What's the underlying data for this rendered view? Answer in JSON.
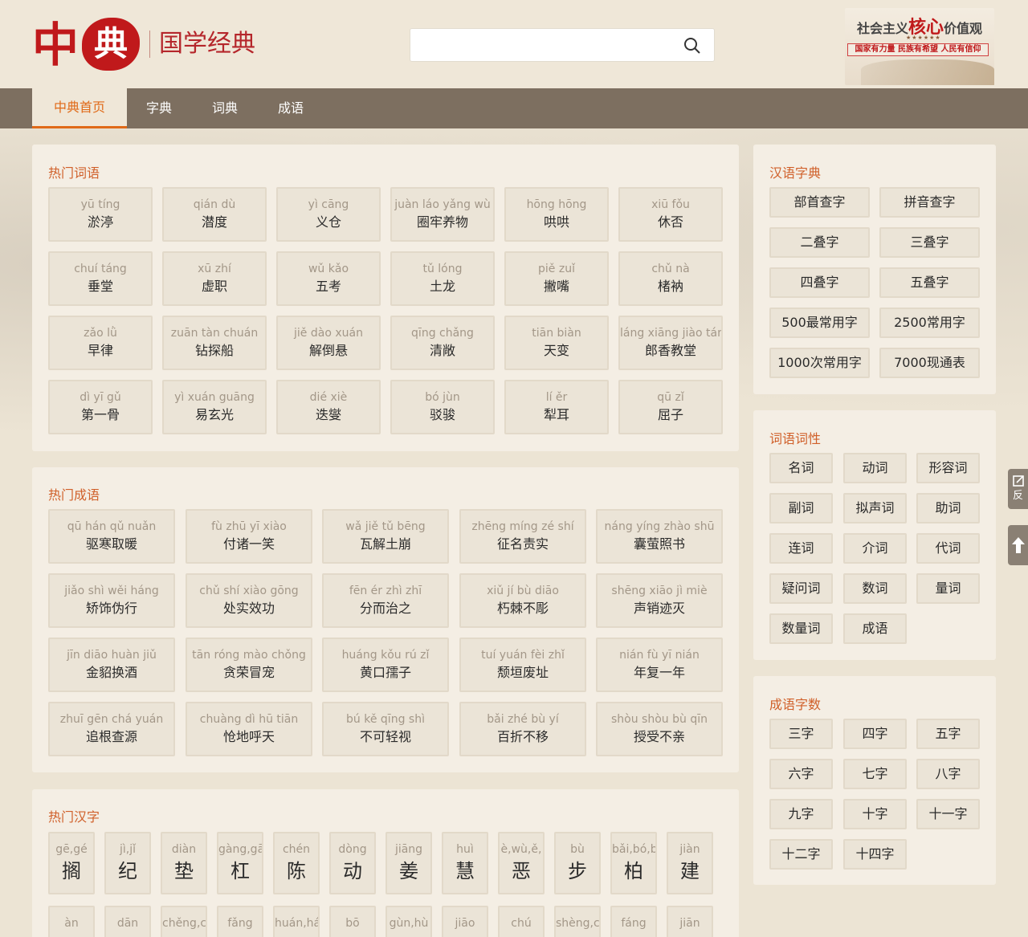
{
  "header": {
    "logo_char1": "中",
    "logo_char2": "典",
    "site_name": "国学经典",
    "search_placeholder": "",
    "ad": {
      "line1_a": "社会主义",
      "line1_b": "核心",
      "line1_c": "价值观",
      "stars": "★★★★★★",
      "line2": "国家有力量 民族有希望 人民有信仰"
    }
  },
  "nav": {
    "items": [
      "中典首页",
      "字典",
      "词典",
      "成语"
    ],
    "active_index": 0
  },
  "hot_words": {
    "title": "热门词语",
    "items": [
      {
        "py": "yū tíng",
        "zh": "淤渟"
      },
      {
        "py": "qián dù",
        "zh": "潜度"
      },
      {
        "py": "yì cāng",
        "zh": "义仓"
      },
      {
        "py": "juàn láo yǎng wù",
        "zh": "圈牢养物"
      },
      {
        "py": "hōng hōng",
        "zh": "哄哄"
      },
      {
        "py": "xiū fǒu",
        "zh": "休否"
      },
      {
        "py": "chuí táng",
        "zh": "垂堂"
      },
      {
        "py": "xū zhí",
        "zh": "虚职"
      },
      {
        "py": "wǔ kǎo",
        "zh": "五考"
      },
      {
        "py": "tǔ lóng",
        "zh": "土龙"
      },
      {
        "py": "piě zuǐ",
        "zh": "撇嘴"
      },
      {
        "py": "chǔ nà",
        "zh": "楮衲"
      },
      {
        "py": "zǎo lǜ",
        "zh": "早律"
      },
      {
        "py": "zuān tàn chuán",
        "zh": "钻探船"
      },
      {
        "py": "jiě dào xuán",
        "zh": "解倒悬"
      },
      {
        "py": "qīng chǎng",
        "zh": "清敞"
      },
      {
        "py": "tiān biàn",
        "zh": "天变"
      },
      {
        "py": "láng xiāng jiào tán",
        "zh": "郎香教堂"
      },
      {
        "py": "dì yī gǔ",
        "zh": "第一骨"
      },
      {
        "py": "yì xuán guāng",
        "zh": "易玄光"
      },
      {
        "py": "dié xiè",
        "zh": "迭燮"
      },
      {
        "py": "bó jùn",
        "zh": "驳骏"
      },
      {
        "py": "lí ěr",
        "zh": "犁耳"
      },
      {
        "py": "qū zǐ",
        "zh": "屈子"
      }
    ]
  },
  "hot_idioms": {
    "title": "热门成语",
    "items": [
      {
        "py": "qū hán qǔ nuǎn",
        "zh": "驱寒取暖"
      },
      {
        "py": "fù zhū yī xiào",
        "zh": "付诸一笑"
      },
      {
        "py": "wǎ jiě tǔ bēng",
        "zh": "瓦解土崩"
      },
      {
        "py": "zhēng míng zé shí",
        "zh": "征名责实"
      },
      {
        "py": "náng yíng zhào shū",
        "zh": "囊萤照书"
      },
      {
        "py": "jiǎo shì wěi háng",
        "zh": "矫饰伪行"
      },
      {
        "py": "chǔ shí xiào gōng",
        "zh": "处实效功"
      },
      {
        "py": "fēn ér zhì zhī",
        "zh": "分而治之"
      },
      {
        "py": "xiǔ jí bù diāo",
        "zh": "朽棘不彫"
      },
      {
        "py": "shēng xiāo jì miè",
        "zh": "声销迹灭"
      },
      {
        "py": "jīn diāo huàn jiǔ",
        "zh": "金貂换酒"
      },
      {
        "py": "tān róng mào chǒng",
        "zh": "贪荣冒宠"
      },
      {
        "py": "huáng kǒu rú zǐ",
        "zh": "黄口孺子"
      },
      {
        "py": "tuí yuán fèi zhǐ",
        "zh": "颓垣废址"
      },
      {
        "py": "nián fù yī nián",
        "zh": "年复一年"
      },
      {
        "py": "zhuī gēn chá yuán",
        "zh": "追根查源"
      },
      {
        "py": "chuàng dì hū tiān",
        "zh": "怆地呼天"
      },
      {
        "py": "bú kě qīng shì",
        "zh": "不可轻视"
      },
      {
        "py": "bǎi zhé bù yí",
        "zh": "百折不移"
      },
      {
        "py": "shòu shòu bù qīn",
        "zh": "授受不亲"
      }
    ]
  },
  "hot_chars": {
    "title": "热门汉字",
    "row1": [
      {
        "py": "gē,gé",
        "zh": "搁"
      },
      {
        "py": "jì,jǐ",
        "zh": "纪"
      },
      {
        "py": "diàn",
        "zh": "垫"
      },
      {
        "py": "gàng,gā",
        "zh": "杠"
      },
      {
        "py": "chén",
        "zh": "陈"
      },
      {
        "py": "dòng",
        "zh": "动"
      },
      {
        "py": "jiāng",
        "zh": "姜"
      },
      {
        "py": "huì",
        "zh": "慧"
      },
      {
        "py": "è,wù,ě,",
        "zh": "恶"
      },
      {
        "py": "bù",
        "zh": "步"
      },
      {
        "py": "bǎi,bó,b",
        "zh": "柏"
      },
      {
        "py": "jiàn",
        "zh": "建"
      }
    ],
    "row2": [
      {
        "py": "àn"
      },
      {
        "py": "dān"
      },
      {
        "py": "chěng,c"
      },
      {
        "py": "fǎng"
      },
      {
        "py": "huán,há"
      },
      {
        "py": "bō"
      },
      {
        "py": "gùn,hù"
      },
      {
        "py": "jiāo"
      },
      {
        "py": "chú"
      },
      {
        "py": "shèng,c"
      },
      {
        "py": "fáng"
      },
      {
        "py": "jiān"
      }
    ]
  },
  "dict": {
    "title": "汉语字典",
    "items": [
      "部首查字",
      "拼音查字",
      "二叠字",
      "三叠字",
      "四叠字",
      "五叠字",
      "500最常用字",
      "2500常用字",
      "1000次常用字",
      "7000现通表"
    ]
  },
  "pos": {
    "title": "词语词性",
    "items": [
      "名词",
      "动词",
      "形容词",
      "副词",
      "拟声词",
      "助词",
      "连词",
      "介词",
      "代词",
      "疑问词",
      "数词",
      "量词",
      "数量词",
      "成语"
    ]
  },
  "idiom_len": {
    "title": "成语字数",
    "items": [
      "三字",
      "四字",
      "五字",
      "六字",
      "七字",
      "八字",
      "九字",
      "十字",
      "十一字",
      "十二字",
      "十四字"
    ]
  },
  "float": {
    "feedback": "反"
  }
}
